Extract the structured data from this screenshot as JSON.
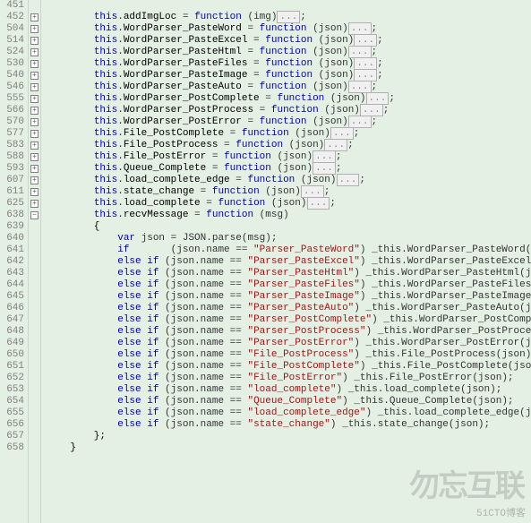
{
  "watermark": "51CTO博客",
  "wm_logo": "勿忘互联",
  "lines": [
    {
      "num": "451",
      "fold": "",
      "ind": "",
      "code": ""
    },
    {
      "num": "452",
      "fold": "+",
      "ind": "        ",
      "this": "this",
      "dot1": ".",
      "member": "addImgLoc",
      "eq": " = ",
      "fn": "function",
      "args": " (img)",
      "tf": "...",
      "end": ";"
    },
    {
      "num": "504",
      "fold": "+",
      "ind": "        ",
      "this": "this",
      "dot1": ".",
      "member": "WordParser_PasteWord",
      "eq": " = ",
      "fn": "function",
      "args": " (json)",
      "tf": "...",
      "end": ";"
    },
    {
      "num": "514",
      "fold": "+",
      "ind": "        ",
      "this": "this",
      "dot1": ".",
      "member": "WordParser_PasteExcel",
      "eq": " = ",
      "fn": "function",
      "args": " (json)",
      "tf": "...",
      "end": ";"
    },
    {
      "num": "524",
      "fold": "+",
      "ind": "        ",
      "this": "this",
      "dot1": ".",
      "member": "WordParser_PasteHtml",
      "eq": " = ",
      "fn": "function",
      "args": " (json)",
      "tf": "...",
      "end": ";"
    },
    {
      "num": "530",
      "fold": "+",
      "ind": "        ",
      "this": "this",
      "dot1": ".",
      "member": "WordParser_PasteFiles",
      "eq": " = ",
      "fn": "function",
      "args": " (json)",
      "tf": "...",
      "end": ";"
    },
    {
      "num": "540",
      "fold": "+",
      "ind": "        ",
      "this": "this",
      "dot1": ".",
      "member": "WordParser_PasteImage",
      "eq": " = ",
      "fn": "function",
      "args": " (json)",
      "tf": "...",
      "end": ";"
    },
    {
      "num": "546",
      "fold": "+",
      "ind": "        ",
      "this": "this",
      "dot1": ".",
      "member": "WordParser_PasteAuto",
      "eq": " = ",
      "fn": "function",
      "args": " (json)",
      "tf": "...",
      "end": ";"
    },
    {
      "num": "555",
      "fold": "+",
      "ind": "        ",
      "this": "this",
      "dot1": ".",
      "member": "WordParser_PostComplete",
      "eq": " = ",
      "fn": "function",
      "args": " (json)",
      "tf": "...",
      "end": ";"
    },
    {
      "num": "566",
      "fold": "+",
      "ind": "        ",
      "this": "this",
      "dot1": ".",
      "member": "WordParser_PostProcess",
      "eq": " = ",
      "fn": "function",
      "args": " (json)",
      "tf": "...",
      "end": ";"
    },
    {
      "num": "570",
      "fold": "+",
      "ind": "        ",
      "this": "this",
      "dot1": ".",
      "member": "WordParser_PostError",
      "eq": " = ",
      "fn": "function",
      "args": " (json)",
      "tf": "...",
      "end": ";"
    },
    {
      "num": "577",
      "fold": "+",
      "ind": "        ",
      "this": "this",
      "dot1": ".",
      "member": "File_PostComplete",
      "eq": " = ",
      "fn": "function",
      "args": " (json)",
      "tf": "...",
      "end": ";"
    },
    {
      "num": "583",
      "fold": "+",
      "ind": "        ",
      "this": "this",
      "dot1": ".",
      "member": "File_PostProcess",
      "eq": " = ",
      "fn": "function",
      "args": " (json)",
      "tf": "...",
      "end": ";"
    },
    {
      "num": "588",
      "fold": "+",
      "ind": "        ",
      "this": "this",
      "dot1": ".",
      "member": "File_PostError",
      "eq": " = ",
      "fn": "function",
      "args": " (json)",
      "tf": "...",
      "end": ";"
    },
    {
      "num": "593",
      "fold": "+",
      "ind": "        ",
      "this": "this",
      "dot1": ".",
      "member": "Queue_Complete",
      "eq": " = ",
      "fn": "function",
      "args": " (json)",
      "tf": "...",
      "end": ";"
    },
    {
      "num": "607",
      "fold": "+",
      "ind": "        ",
      "this": "this",
      "dot1": ".",
      "member": "load_complete_edge",
      "eq": " = ",
      "fn": "function",
      "args": " (json)",
      "tf": "...",
      "end": ";"
    },
    {
      "num": "611",
      "fold": "+",
      "ind": "        ",
      "this": "this",
      "dot1": ".",
      "member": "state_change",
      "eq": " = ",
      "fn": "function",
      "args": " (json)",
      "tf": "...",
      "end": ";"
    },
    {
      "num": "625",
      "fold": "+",
      "ind": "        ",
      "this": "this",
      "dot1": ".",
      "member": "load_complete",
      "eq": " = ",
      "fn": "function",
      "args": " (json)",
      "tf": "...",
      "end": ";"
    },
    {
      "num": "638",
      "fold": "-",
      "ind": "        ",
      "this": "this",
      "dot1": ".",
      "member": "recvMessage",
      "eq": " = ",
      "fn": "function",
      "args": " (msg)",
      "tf": "",
      "end": ""
    },
    {
      "num": "639",
      "raw": "        {"
    },
    {
      "num": "640",
      "ind": "            ",
      "kw1": "var",
      "txt1": " json = JSON.parse(msg);"
    },
    {
      "num": "641",
      "ind": "            ",
      "kw1": "if",
      "pad": "      ",
      "txt1": " (json.name == ",
      "str": "\"Parser_PasteWord\"",
      "txt2": ") _this.WordParser_PasteWord(json);"
    },
    {
      "num": "642",
      "ind": "            ",
      "kw1": "else if",
      "txt1": " (json.name == ",
      "str": "\"Parser_PasteExcel\"",
      "txt2": ") _this.WordParser_PasteExcel(json);"
    },
    {
      "num": "643",
      "ind": "            ",
      "kw1": "else if",
      "txt1": " (json.name == ",
      "str": "\"Parser_PasteHtml\"",
      "txt2": ") _this.WordParser_PasteHtml(json);"
    },
    {
      "num": "644",
      "ind": "            ",
      "kw1": "else if",
      "txt1": " (json.name == ",
      "str": "\"Parser_PasteFiles\"",
      "txt2": ") _this.WordParser_PasteFiles(json);"
    },
    {
      "num": "645",
      "ind": "            ",
      "kw1": "else if",
      "txt1": " (json.name == ",
      "str": "\"Parser_PasteImage\"",
      "txt2": ") _this.WordParser_PasteImage(json);"
    },
    {
      "num": "646",
      "ind": "            ",
      "kw1": "else if",
      "txt1": " (json.name == ",
      "str": "\"Parser_PasteAuto\"",
      "txt2": ") _this.WordParser_PasteAuto(json);"
    },
    {
      "num": "647",
      "ind": "            ",
      "kw1": "else if",
      "txt1": " (json.name == ",
      "str": "\"Parser_PostComplete\"",
      "txt2": ") _this.WordParser_PostComplete(json);"
    },
    {
      "num": "648",
      "ind": "            ",
      "kw1": "else if",
      "txt1": " (json.name == ",
      "str": "\"Parser_PostProcess\"",
      "txt2": ") _this.WordParser_PostProcess(json);"
    },
    {
      "num": "649",
      "ind": "            ",
      "kw1": "else if",
      "txt1": " (json.name == ",
      "str": "\"Parser_PostError\"",
      "txt2": ") _this.WordParser_PostError(json);"
    },
    {
      "num": "650",
      "ind": "            ",
      "kw1": "else if",
      "txt1": " (json.name == ",
      "str": "\"File_PostProcess\"",
      "txt2": ") _this.File_PostProcess(json);"
    },
    {
      "num": "651",
      "ind": "            ",
      "kw1": "else if",
      "txt1": " (json.name == ",
      "str": "\"File_PostComplete\"",
      "txt2": ") _this.File_PostComplete(json);"
    },
    {
      "num": "652",
      "ind": "            ",
      "kw1": "else if",
      "txt1": " (json.name == ",
      "str": "\"File_PostError\"",
      "txt2": ") _this.File_PostError(json);"
    },
    {
      "num": "653",
      "ind": "            ",
      "kw1": "else if",
      "txt1": " (json.name == ",
      "str": "\"load_complete\"",
      "txt2": ") _this.load_complete(json);"
    },
    {
      "num": "654",
      "ind": "            ",
      "kw1": "else if",
      "txt1": " (json.name == ",
      "str": "\"Queue_Complete\"",
      "txt2": ") _this.Queue_Complete(json);"
    },
    {
      "num": "655",
      "ind": "            ",
      "kw1": "else if",
      "txt1": " (json.name == ",
      "str": "\"load_complete_edge\"",
      "txt2": ") _this.load_complete_edge(json);"
    },
    {
      "num": "656",
      "ind": "            ",
      "kw1": "else if",
      "txt1": " (json.name == ",
      "str": "\"state_change\"",
      "txt2": ") _this.state_change(json);"
    },
    {
      "num": "657",
      "raw": "        };"
    },
    {
      "num": "658",
      "raw": "    }"
    }
  ]
}
